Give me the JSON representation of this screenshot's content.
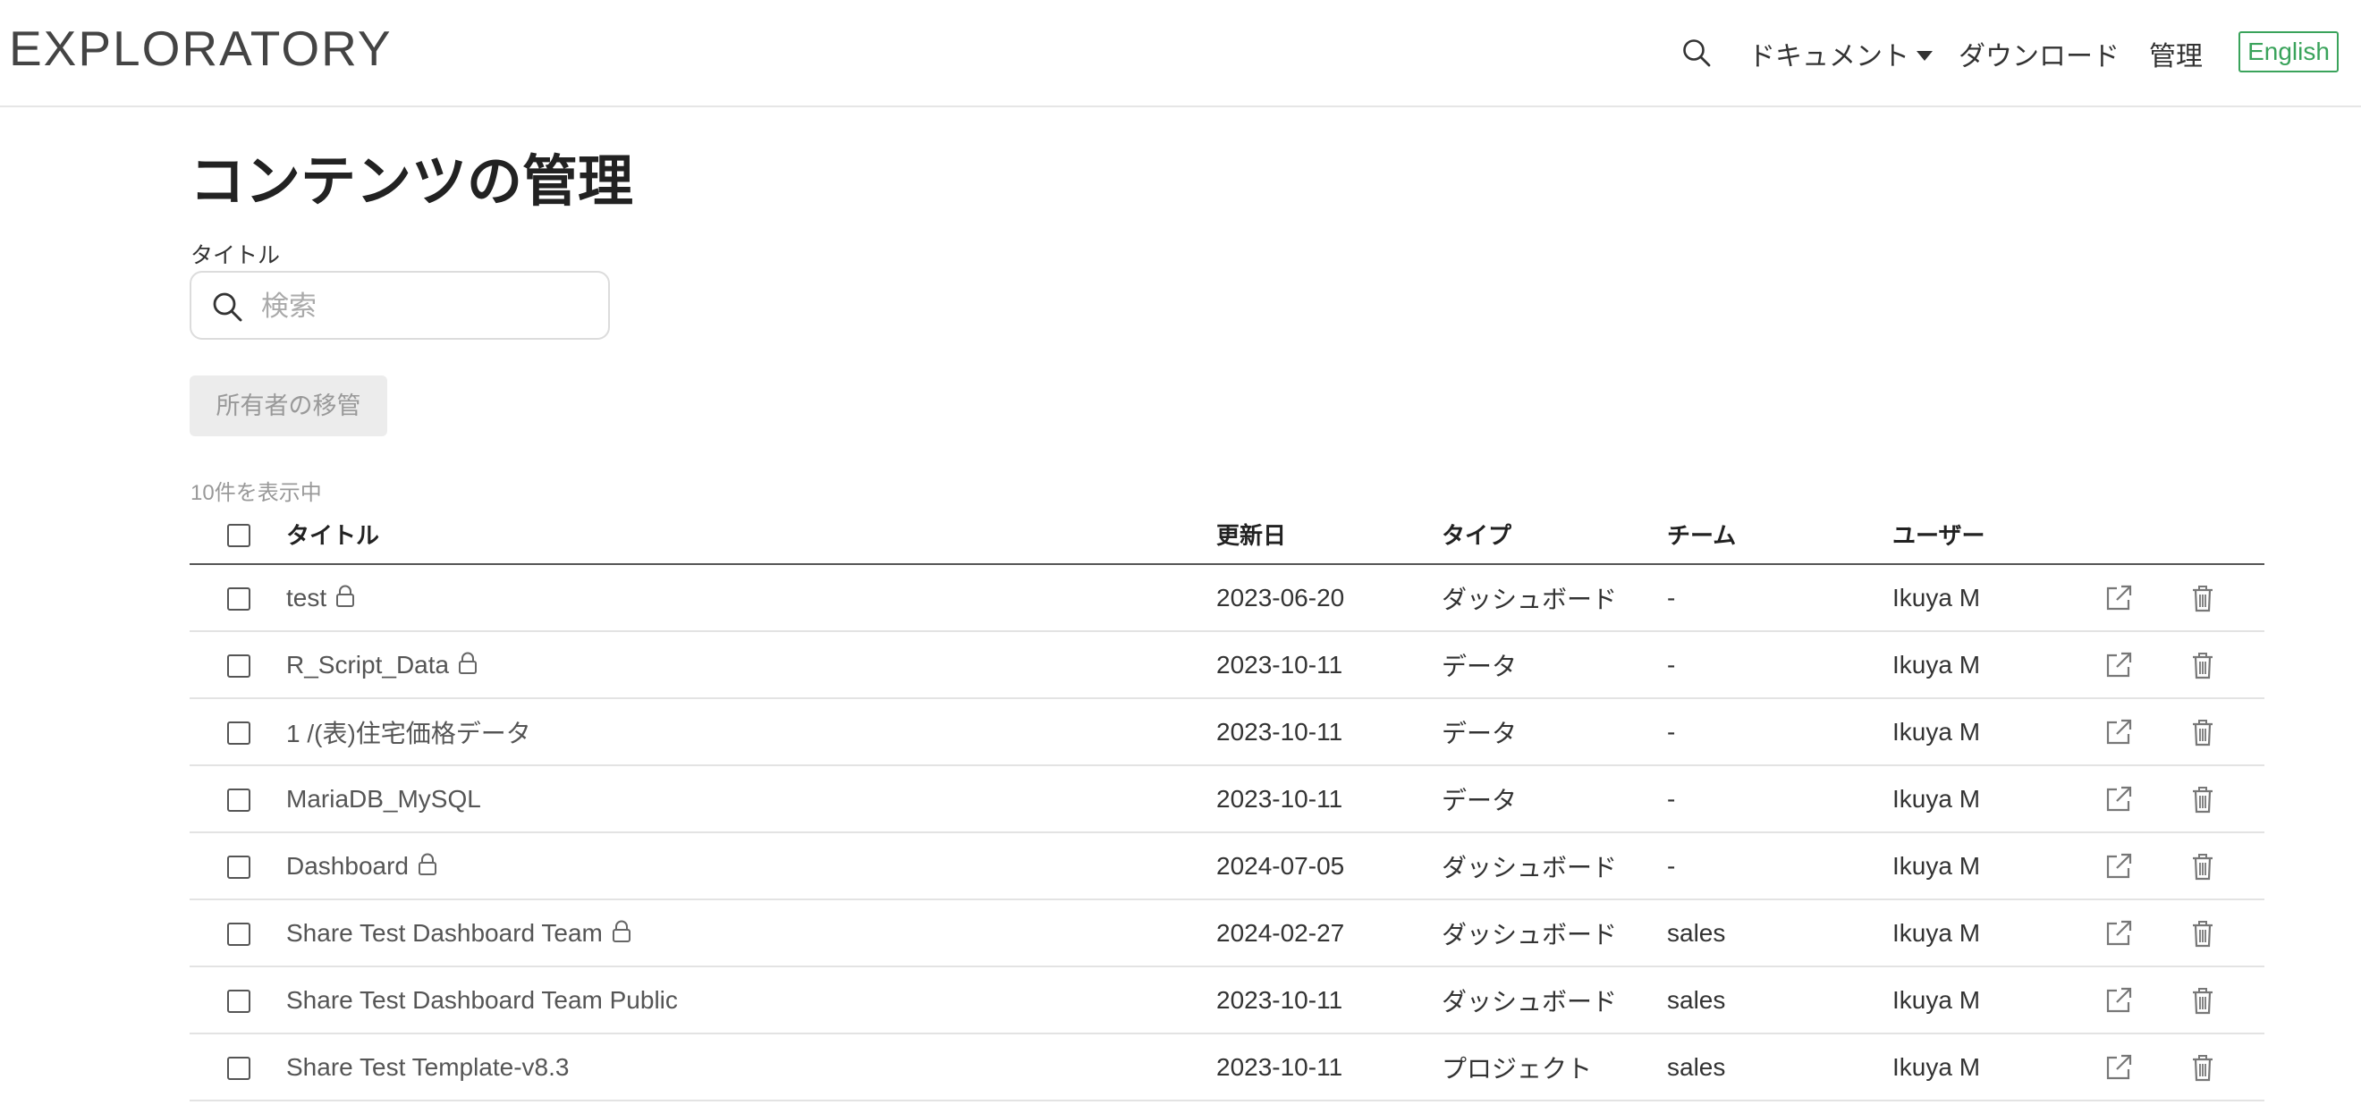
{
  "header": {
    "logo": "EXPLORATORY",
    "nav": {
      "docs_label": "ドキュメント",
      "download_label": "ダウンロード",
      "admin_label": "管理",
      "language_label": "English"
    }
  },
  "main": {
    "title": "コンテンツの管理",
    "filter": {
      "label": "タイトル",
      "placeholder": "検索",
      "value": ""
    },
    "transfer_button": "所有者の移管",
    "count_text": "10件を表示中",
    "table": {
      "columns": {
        "title": "タイトル",
        "updated": "更新日",
        "type": "タイプ",
        "team": "チーム",
        "user": "ユーザー"
      },
      "rows": [
        {
          "title": "test",
          "locked": true,
          "updated": "2023-06-20",
          "type": "ダッシュボード",
          "team": "-",
          "user": "Ikuya M"
        },
        {
          "title": "R_Script_Data",
          "locked": true,
          "updated": "2023-10-11",
          "type": "データ",
          "team": "-",
          "user": "Ikuya M"
        },
        {
          "title": "1 /(表)住宅価格データ",
          "locked": false,
          "updated": "2023-10-11",
          "type": "データ",
          "team": "-",
          "user": "Ikuya M"
        },
        {
          "title": "MariaDB_MySQL",
          "locked": false,
          "updated": "2023-10-11",
          "type": "データ",
          "team": "-",
          "user": "Ikuya M"
        },
        {
          "title": "Dashboard",
          "locked": true,
          "updated": "2024-07-05",
          "type": "ダッシュボード",
          "team": "-",
          "user": "Ikuya M"
        },
        {
          "title": "Share Test Dashboard Team",
          "locked": true,
          "updated": "2024-02-27",
          "type": "ダッシュボード",
          "team": "sales",
          "user": "Ikuya M"
        },
        {
          "title": "Share Test Dashboard Team Public",
          "locked": false,
          "updated": "2023-10-11",
          "type": "ダッシュボード",
          "team": "sales",
          "user": "Ikuya M"
        },
        {
          "title": "Share Test Template-v8.3",
          "locked": false,
          "updated": "2023-10-11",
          "type": "プロジェクト",
          "team": "sales",
          "user": "Ikuya M"
        }
      ]
    }
  },
  "colors": {
    "accent_green": "#3aa35b",
    "disabled_bg": "#ececec",
    "muted_text": "#999999"
  },
  "icons": [
    "search-icon",
    "caret-down-icon",
    "lock-icon",
    "external-link-icon",
    "trash-icon"
  ]
}
